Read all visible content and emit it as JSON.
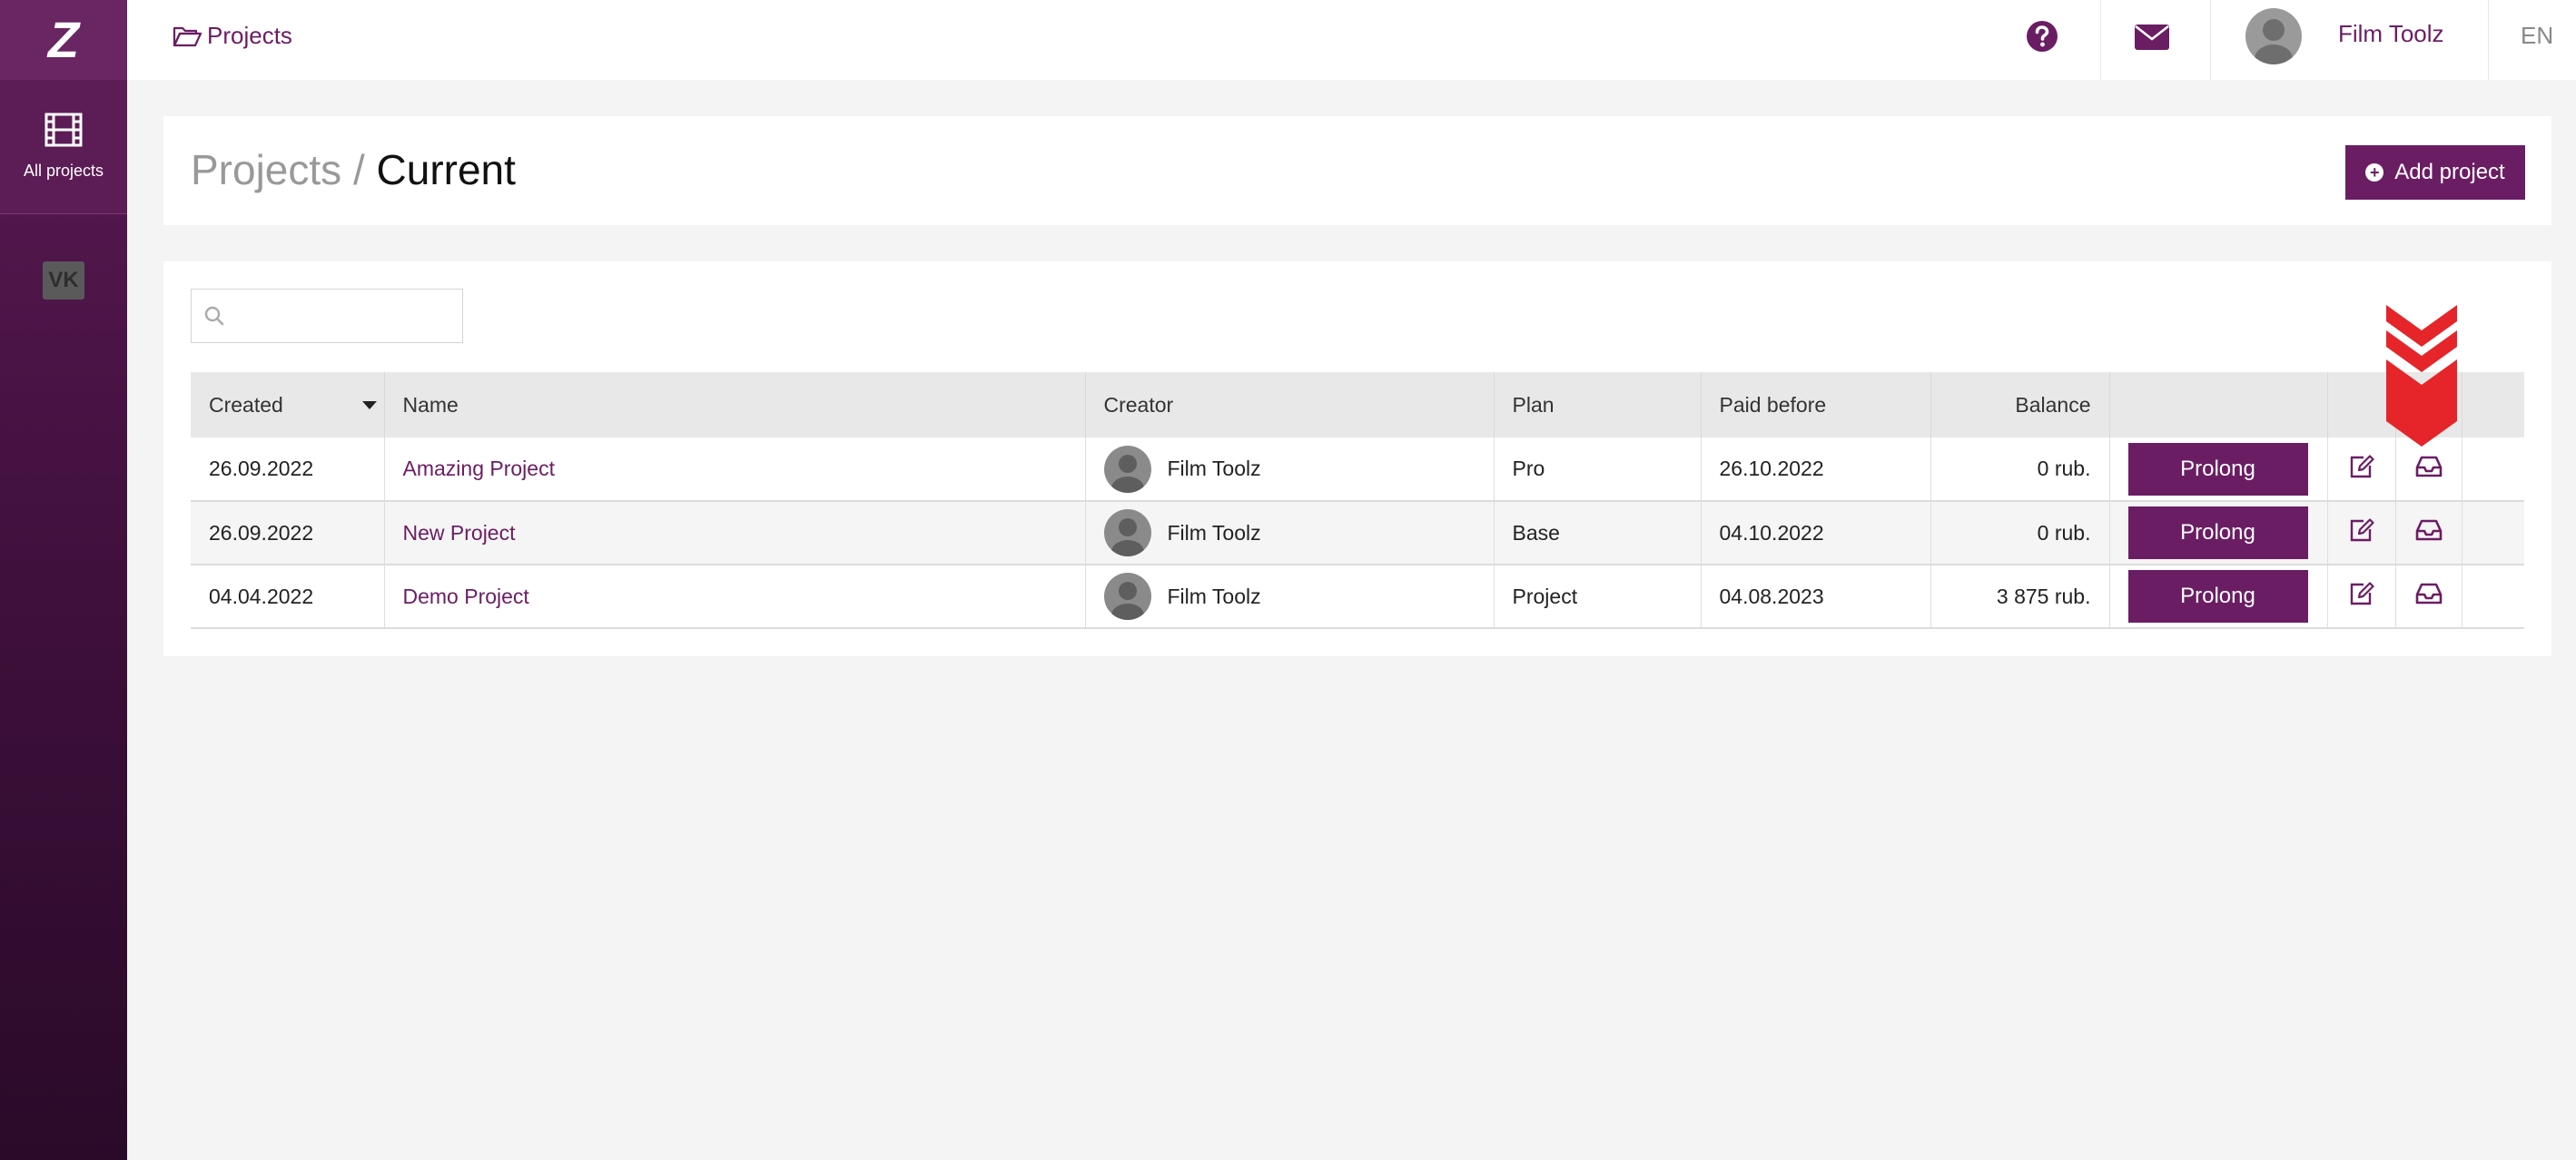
{
  "sidebar": {
    "logo": "Z",
    "items": [
      {
        "label": "All projects",
        "icon": "film-icon"
      }
    ],
    "social": {
      "icon": "vk-icon",
      "label": "VK"
    }
  },
  "topbar": {
    "breadcrumb": "Projects",
    "user_name": "Film Toolz",
    "language": "EN"
  },
  "title": {
    "section": "Projects",
    "separator": " / ",
    "current": "Current"
  },
  "actions": {
    "add_project": "Add project"
  },
  "search": {
    "placeholder": "",
    "value": ""
  },
  "table": {
    "columns": [
      "Created",
      "Name",
      "Creator",
      "Plan",
      "Paid before",
      "Balance",
      "",
      "",
      "",
      ""
    ],
    "rows": [
      {
        "created": "26.09.2022",
        "name": "Amazing Project",
        "creator": "Film Toolz",
        "plan": "Pro",
        "paid_before": "26.10.2022",
        "balance": "0 rub.",
        "action": "Prolong"
      },
      {
        "created": "26.09.2022",
        "name": "New Project",
        "creator": "Film Toolz",
        "plan": "Base",
        "paid_before": "04.10.2022",
        "balance": "0 rub.",
        "action": "Prolong"
      },
      {
        "created": "04.04.2022",
        "name": "Demo Project",
        "creator": "Film Toolz",
        "plan": "Project",
        "paid_before": "04.08.2023",
        "balance": "3 875 rub.",
        "action": "Prolong"
      }
    ]
  },
  "colors": {
    "brand": "#6b1d64",
    "highlight_arrow": "#e5252a"
  }
}
